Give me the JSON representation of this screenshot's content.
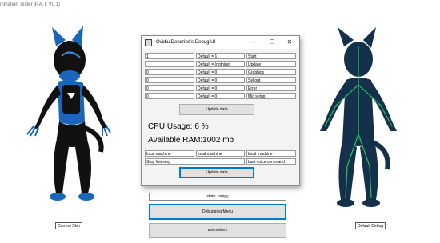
{
  "window": {
    "title": "nimation Tester [P.A.T. V0.1]"
  },
  "debug_window": {
    "title": "Ovidiu Dendrino's Debug UI",
    "controls": {
      "minimize": "—",
      "maximize": "☐",
      "close": "✕"
    },
    "rows": [
      {
        "value": "1",
        "default": "Default = 1",
        "name": "Start"
      },
      {
        "value": "",
        "default": "Default = (nothing)",
        "name": "Update"
      },
      {
        "value": "0",
        "default": "Default = 0",
        "name": "Graphics"
      },
      {
        "value": "0",
        "default": "Default = 0",
        "name": "Sellout"
      },
      {
        "value": "0",
        "default": "Default = 0",
        "name": "Error"
      },
      {
        "value": "0",
        "default": "Default = 0",
        "name": "Mic setup"
      }
    ],
    "update_button_1": "Update data",
    "cpu_usage": "CPU Usage: 6 %",
    "available_ram": "Available RAM:1002 mb",
    "machines": [
      "local machine",
      "local machine",
      "local machine"
    ],
    "listen_status": "Stop listening",
    "last_voice": "Last voice command",
    "update_button_2": "Update data"
  },
  "main": {
    "state": "state: happy",
    "debug_menu_button": "Debugging Menu",
    "animation_button": "animation1",
    "current_skin_label": "Current Skin",
    "default_debug_label": "Default Debug"
  },
  "colors": {
    "accent": "#0078d7",
    "skin_blue": "#1a66b8",
    "skin_black": "#111111",
    "debug_dark": "#14304a",
    "debug_bone": "#22c55e"
  }
}
